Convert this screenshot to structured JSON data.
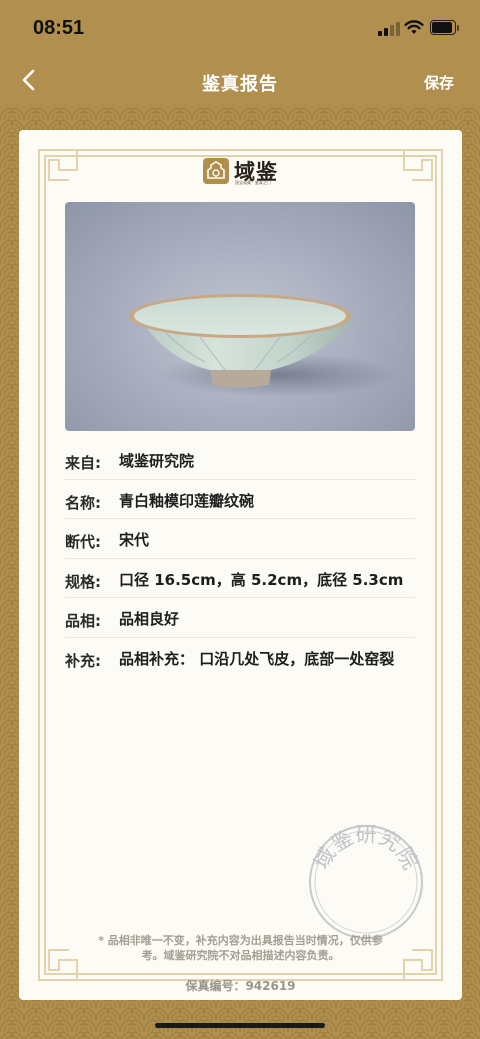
{
  "status_bar": {
    "time": "08:51"
  },
  "nav": {
    "title": "鉴真报告",
    "save_label": "保存"
  },
  "brand": {
    "name": "域鉴",
    "tagline": "国宝收藏 · 鉴真之门"
  },
  "colors": {
    "gold": "#b08f4d",
    "card": "#fdfbf6",
    "frame": "#e2d3ac"
  },
  "details": [
    {
      "label": "来自:",
      "value": "域鉴研究院"
    },
    {
      "label": "名称:",
      "value": "青白釉模印莲瓣纹碗"
    },
    {
      "label": "断代:",
      "value": "宋代"
    },
    {
      "label": "规格:",
      "value": "口径 16.5cm，高 5.2cm，底径 5.3cm"
    },
    {
      "label": "品相:",
      "value": "品相良好"
    },
    {
      "label": "补充:",
      "value": "品相补充： 口沿几处飞皮，底部一处窑裂"
    }
  ],
  "seal": {
    "text": "域鉴研究院"
  },
  "note": {
    "line1": "* 品相非唯一不变，补充内容为出具报告当时情况，仅供参",
    "line2": "考。域鉴研究院不对品相描述内容负责。"
  },
  "serial": "保真编号：942619"
}
